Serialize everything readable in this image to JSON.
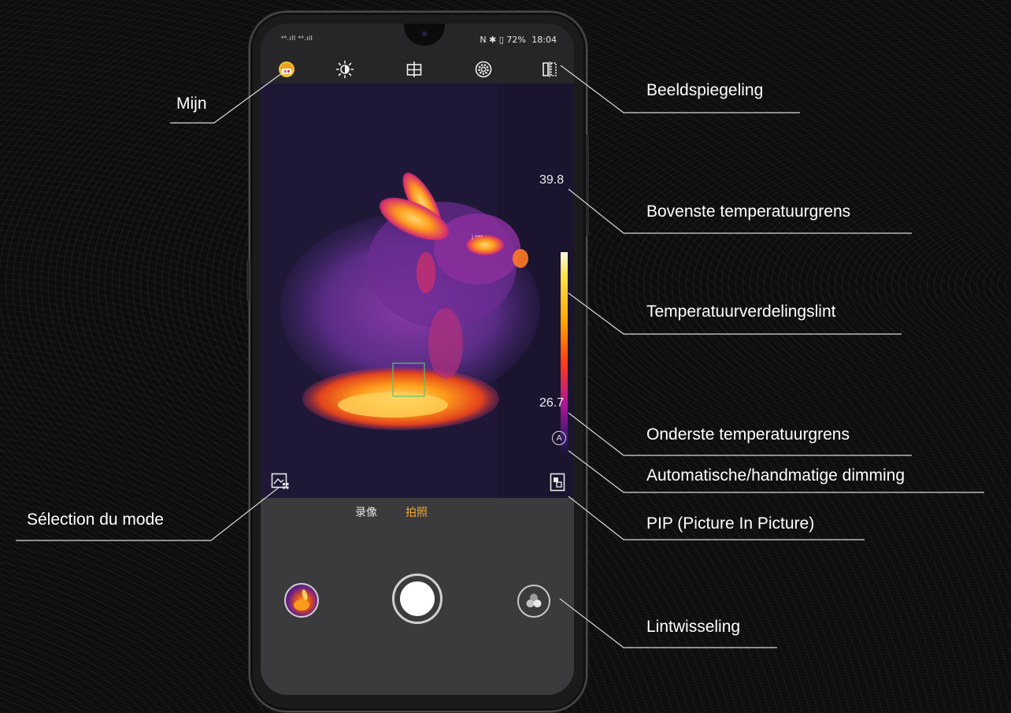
{
  "colors": {
    "background": "#0d0d0d",
    "label_text": "#ffffff",
    "callout_line": "#d9d9d9",
    "mode_active": "#f4a62a",
    "mode_inactive": "#e6e6e6",
    "measure_box": "#59c46b"
  },
  "status_bar": {
    "left_indicators": "⁴⁶.ıll ⁴⁶.ıll",
    "right_indicators": "N ✱ ▯ 72%",
    "time": "18:04"
  },
  "toolbar": {
    "icons": [
      "palette-profile-icon",
      "brightness-icon",
      "center-target-icon",
      "settings-icon",
      "mirror-icon"
    ]
  },
  "viewport": {
    "temp_max": "39.8",
    "temp_min": "26.7",
    "auto_dimming_label": "A",
    "mode_select_icon": "mode-select-icon",
    "pip_icon": "pip-icon"
  },
  "bottom": {
    "mode_video": "录像",
    "mode_photo": "拍照",
    "active_mode": "拍照"
  },
  "callouts": {
    "mijn": "Mijn",
    "beeldspiegeling": "Beeldspiegeling",
    "bovenste": "Bovenste temperatuurgrens",
    "lint": "Temperatuurverdelingslint",
    "onderste": "Onderste temperatuurgrens",
    "dimming": "Automatische/handmatige dimming",
    "pip": "PIP (Picture In Picture)",
    "mode": "Sélection du mode",
    "lintwisseling": "Lintwisseling"
  }
}
